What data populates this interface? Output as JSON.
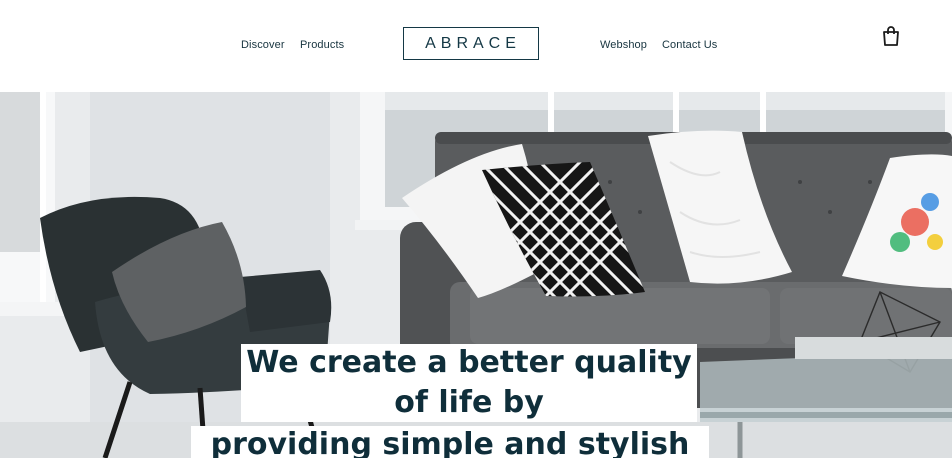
{
  "nav": {
    "left": [
      "Discover",
      "Products"
    ],
    "right": [
      "Webshop",
      "Contact Us"
    ]
  },
  "logo": {
    "text": "ABRACE"
  },
  "icons": {
    "cart": "shopping-bag-icon"
  },
  "hero": {
    "headline": [
      "We create a better quality",
      "of life by",
      "providing simple and stylish"
    ]
  },
  "colors": {
    "text": "#0f2e3a",
    "background": "#ffffff"
  }
}
